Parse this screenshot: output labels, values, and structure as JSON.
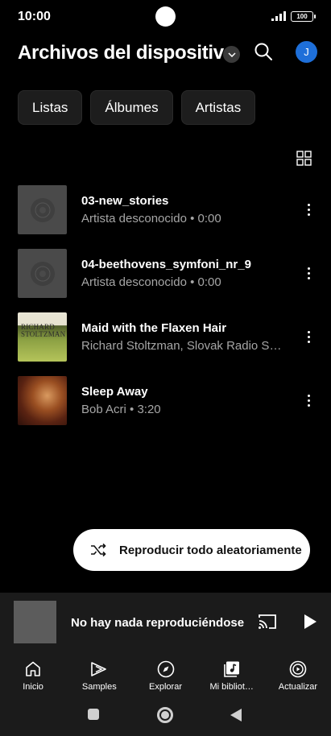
{
  "status": {
    "time": "10:00",
    "battery": "100"
  },
  "header": {
    "title": "Archivos del dispositivo",
    "avatar_letter": "J"
  },
  "chips": [
    {
      "label": "Listas"
    },
    {
      "label": "Álbumes"
    },
    {
      "label": "Artistas"
    }
  ],
  "songs": [
    {
      "title": "03-new_stories",
      "subtitle": "Artista desconocido • 0:00",
      "art": "placeholder-disc"
    },
    {
      "title": "04-beethovens_symfoni_nr_9",
      "subtitle": "Artista desconocido • 0:00",
      "art": "placeholder-disc"
    },
    {
      "title": "Maid with the Flaxen Hair",
      "subtitle": "Richard Stoltzman, Slovak Radio Sy…",
      "art": "album-cover",
      "art_text": [
        "RICHARD",
        "STOLTZMAN"
      ]
    },
    {
      "title": "Sleep Away",
      "subtitle": "Bob Acri • 3:20",
      "art": "album-cover"
    }
  ],
  "shuffle": {
    "label": "Reproducir todo aleatoriamente"
  },
  "mini_player": {
    "text": "No hay nada reproduciéndose"
  },
  "bottom_nav": [
    {
      "label": "Inicio",
      "icon": "home-icon"
    },
    {
      "label": "Samples",
      "icon": "samples-icon"
    },
    {
      "label": "Explorar",
      "icon": "explore-icon"
    },
    {
      "label": "Mi bibliot…",
      "icon": "library-icon"
    },
    {
      "label": "Actualizar",
      "icon": "upgrade-icon"
    }
  ],
  "colors": {
    "background": "#000000",
    "surface": "#1b1b1b",
    "chip": "#1d1d1d",
    "accent_avatar": "#1e6fd9",
    "secondary_text": "#a6a6a6"
  }
}
